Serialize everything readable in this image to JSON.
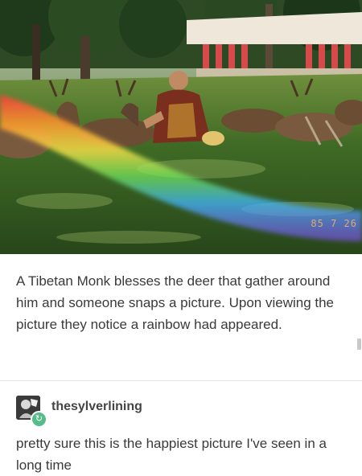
{
  "photo": {
    "date_stamp": "85 7 26"
  },
  "post": {
    "caption": "A Tibetan Monk blesses the deer that gather around him and someone snaps a picture. Upon viewing the picture they notice a rainbow had appeared."
  },
  "reblog": {
    "username": "thesylverlining",
    "badge_icon": "reblog-icon",
    "badge_color": "#56bc8a",
    "text": "pretty sure this is the happiest picture I've seen in a long time"
  }
}
